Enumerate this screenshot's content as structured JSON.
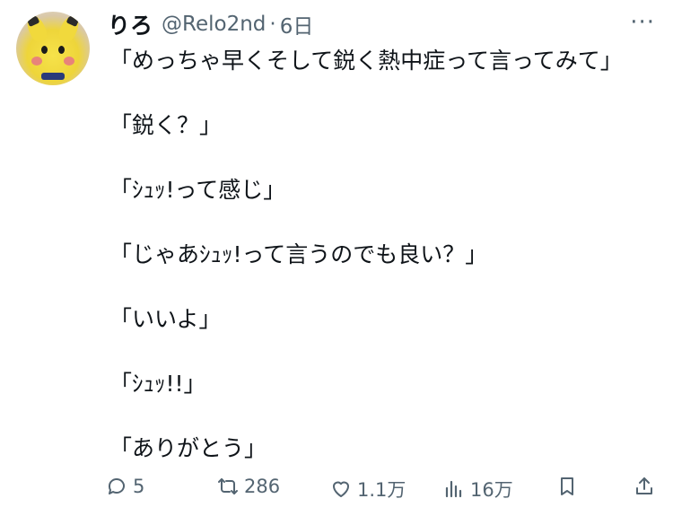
{
  "user": {
    "display_name": "りろ",
    "handle": "@Relo2nd",
    "separator": "·",
    "time": "6日"
  },
  "tweet": {
    "lines": [
      "「めっちゃ早くそして鋭く熱中症って言ってみて」",
      "「鋭く？」",
      "「ｼｭｯ!って感じ」",
      "「じゃあｼｭｯ!って言うのでも良い？」",
      "「いいよ」",
      "「ｼｭｯ!!」",
      "「ありがとう」"
    ]
  },
  "actions": {
    "replies": "5",
    "retweets": "286",
    "likes": "1.1万",
    "views": "16万"
  },
  "more_label": "···"
}
